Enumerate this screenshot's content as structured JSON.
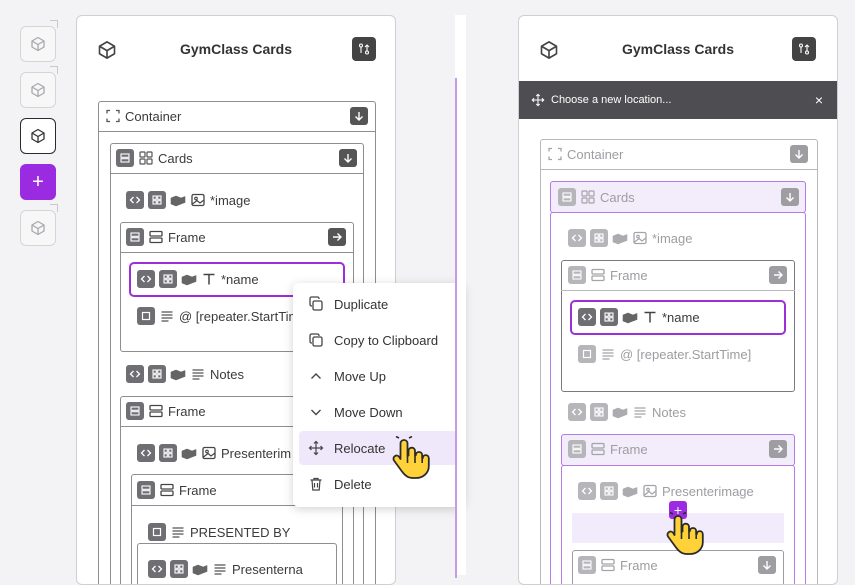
{
  "rail": {
    "items": [
      {
        "name": "page-1",
        "icon": "cube-icon"
      },
      {
        "name": "page-2",
        "icon": "cube-icon"
      },
      {
        "name": "page-3",
        "icon": "cube-icon"
      },
      {
        "name": "add",
        "icon": "plus-icon",
        "label": "+"
      },
      {
        "name": "page-4",
        "icon": "cube-icon"
      }
    ]
  },
  "left_panel": {
    "title": "GymClass Cards",
    "tree": {
      "container": "Container",
      "cards": "Cards",
      "image": "*image",
      "frame1": "Frame",
      "name": "*name",
      "start_time": "@ [repeater.StartTim",
      "notes": "Notes",
      "frame2": "Frame",
      "presenter_image": "Presenterim",
      "frame3": "Frame",
      "presented_by": "PRESENTED BY",
      "presenter_name": "Presenterna"
    }
  },
  "context_menu": {
    "items": [
      {
        "label": "Duplicate",
        "icon": "duplicate-icon"
      },
      {
        "label": "Copy to Clipboard",
        "icon": "copy-icon"
      },
      {
        "label": "Move Up",
        "icon": "chevron-up-icon"
      },
      {
        "label": "Move Down",
        "icon": "chevron-down-icon"
      },
      {
        "label": "Relocate",
        "icon": "move-icon"
      },
      {
        "label": "Delete",
        "icon": "trash-icon"
      }
    ],
    "hovered": "Relocate"
  },
  "right_panel": {
    "title": "GymClass Cards",
    "banner": "Choose a new location...",
    "banner_close": "×",
    "tree": {
      "container": "Container",
      "cards": "Cards",
      "image": "*image",
      "frame1": "Frame",
      "name": "*name",
      "start_time": "@ [repeater.StartTime]",
      "notes": "Notes",
      "frame2": "Frame",
      "presenter_image": "Presenterimage",
      "frame3": "Frame"
    },
    "drop_marker": "+"
  },
  "colors": {
    "accent": "#9b2be0",
    "selected_border": "#9b30d9",
    "banner_bg": "#4e4e52",
    "chip": "#6e6e73"
  }
}
